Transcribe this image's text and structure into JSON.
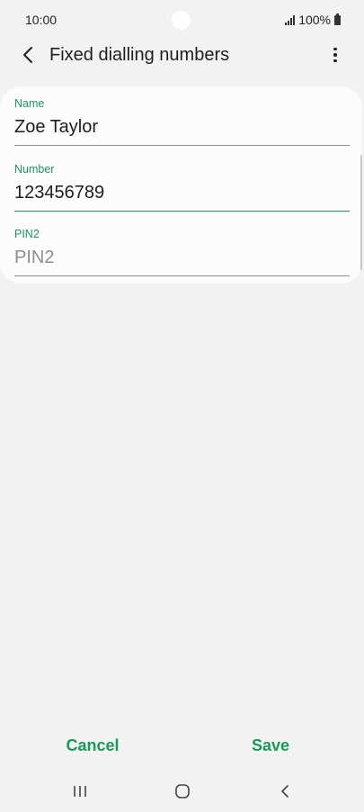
{
  "status_bar": {
    "time": "10:00",
    "battery": "100%"
  },
  "app_bar": {
    "title": "Fixed dialling numbers",
    "back_icon": "chevron-left-icon",
    "more_icon": "more-vertical-icon"
  },
  "form": {
    "fields": [
      {
        "label": "Name",
        "value": "Zoe Taylor",
        "placeholder": ""
      },
      {
        "label": "Number",
        "value": "123456789",
        "placeholder": ""
      },
      {
        "label": "PIN2",
        "value": "",
        "placeholder": "PIN2"
      }
    ]
  },
  "actions": {
    "cancel_label": "Cancel",
    "save_label": "Save"
  },
  "nav_bar": {
    "recent_icon": "recent-apps-icon",
    "home_icon": "home-icon",
    "back_icon": "back-icon"
  },
  "colors": {
    "accent": "#1a9a5a",
    "background": "#f2f2f2",
    "card": "#fcfcfc",
    "text": "#1e1e1e",
    "placeholder": "#8e8e8e"
  }
}
